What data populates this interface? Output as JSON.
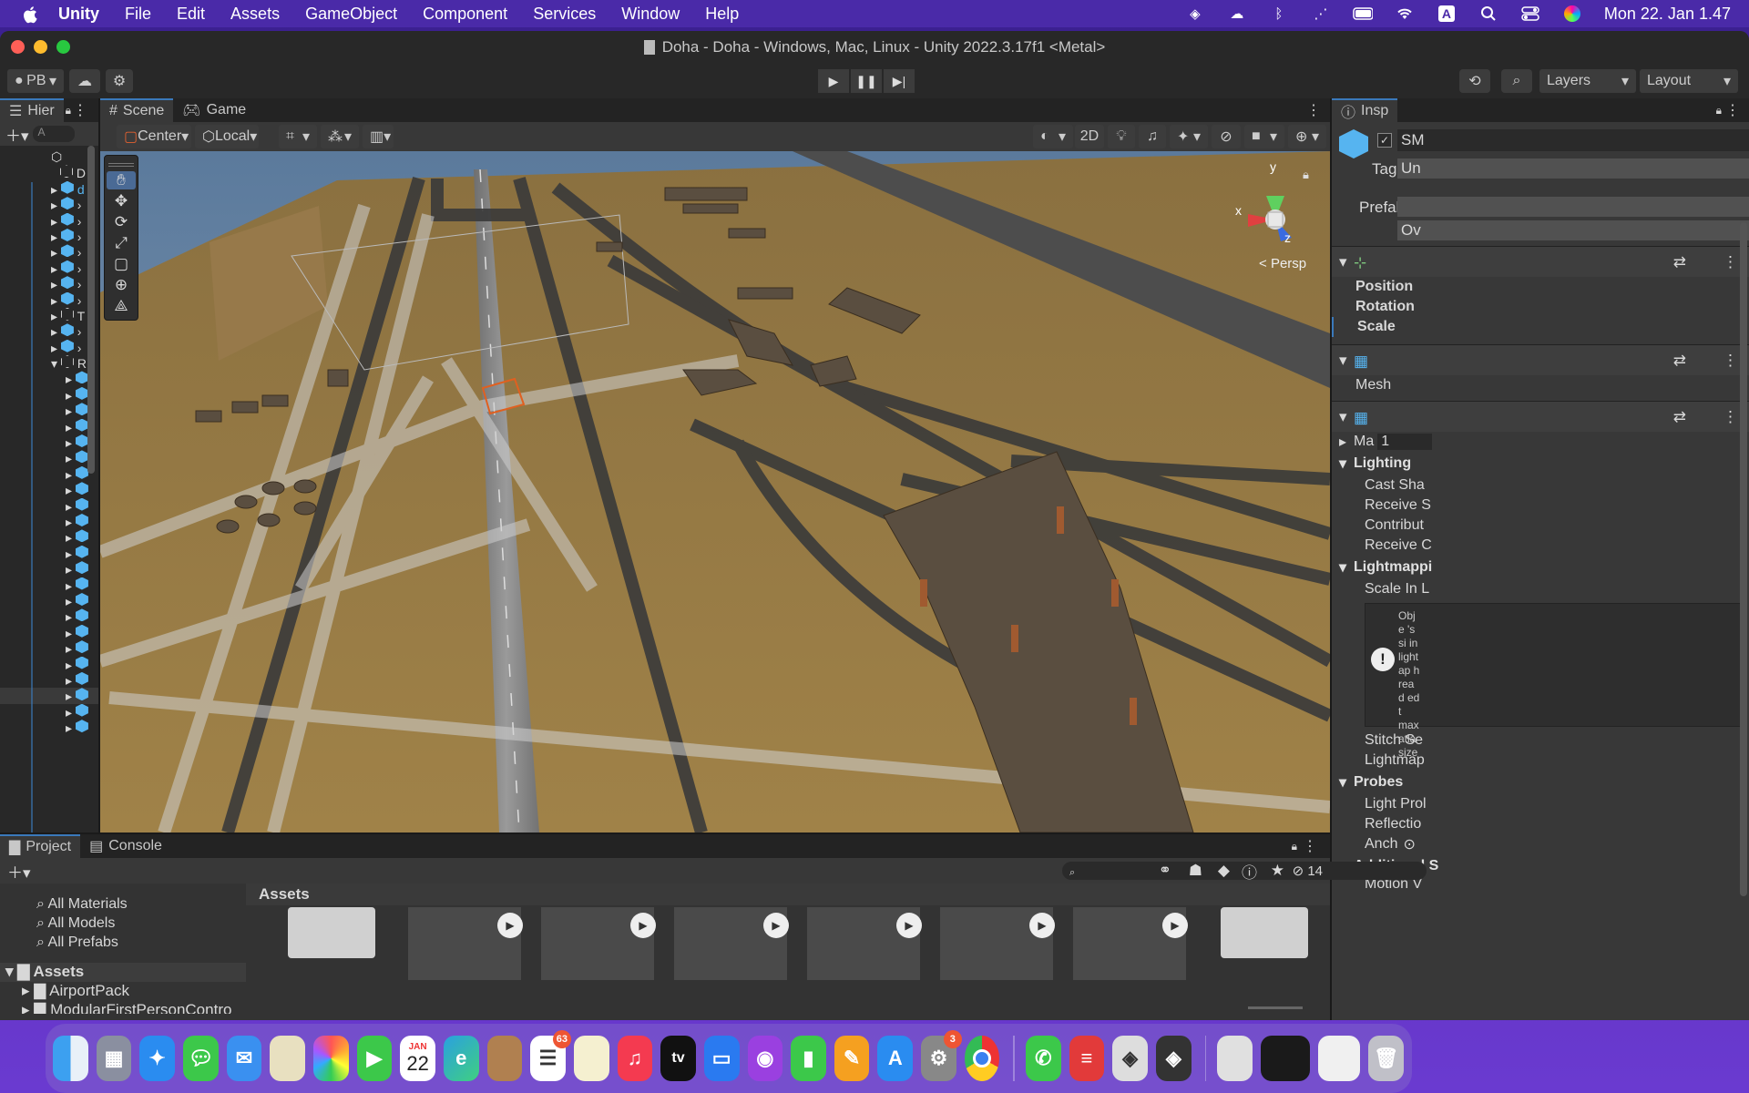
{
  "menubar": {
    "app": "Unity",
    "items": [
      "File",
      "Edit",
      "Assets",
      "GameObject",
      "Component",
      "Services",
      "Window",
      "Help"
    ],
    "input_indicator": "A",
    "clock": "Mon 22. Jan  1.47"
  },
  "window": {
    "title": "Doha - Doha - Windows, Mac, Linux - Unity 2022.3.17f1 <Metal>"
  },
  "toolbar": {
    "account": "PB",
    "layers": "Layers",
    "layout": "Layout"
  },
  "hierarchy": {
    "tab": "Hier",
    "search_placeholder": "A",
    "rows": [
      "D",
      "d",
      "",
      "",
      "",
      "",
      "",
      "",
      "",
      "T",
      "",
      "",
      "R"
    ]
  },
  "scene": {
    "tabs": [
      "Scene",
      "Game"
    ],
    "pivot": "Center",
    "space": "Local",
    "mode_2d": "2D",
    "gizmo": {
      "y": "y",
      "x": "x",
      "z": "z",
      "persp": "Persp"
    }
  },
  "inspector": {
    "tab": "Insp",
    "object_name": "SM",
    "tag_label": "Tag",
    "tag_value": "Un",
    "prefab_label": "Prefab",
    "prefab_overrides": "Ov",
    "transform": [
      "Position",
      "Rotation",
      "Scale"
    ],
    "mesh_label": "Mesh",
    "materials_label": "Ma",
    "materials_count": "1",
    "lighting": {
      "header": "Lighting",
      "rows": [
        "Cast Sha",
        "Receive S",
        "Contribut",
        "Receive C"
      ]
    },
    "lightmapping": {
      "header": "Lightmappi",
      "scale": "Scale In L",
      "warning": "Obje 's si in light ap h read ed t max atla size",
      "rows": [
        "Stitch Se",
        "Lightmap"
      ]
    },
    "probes": {
      "header": "Probes",
      "rows": [
        "Light Prol",
        "Reflectio",
        "Anch"
      ]
    },
    "additional": "Additional S",
    "motion": "Motion V"
  },
  "project": {
    "tabs": [
      "Project",
      "Console"
    ],
    "favorites": [
      "All Materials",
      "All Models",
      "All Prefabs"
    ],
    "assets_root": "Assets",
    "tree": [
      "AirportPack",
      "ModularFirstPersonContro"
    ],
    "breadcrumb": "Assets",
    "hidden_count": "14"
  },
  "dock": {
    "calendar_month": "JAN",
    "calendar_day": "22",
    "reminders_badge": "63",
    "settings_badge": "3",
    "tv_label": "tv"
  }
}
